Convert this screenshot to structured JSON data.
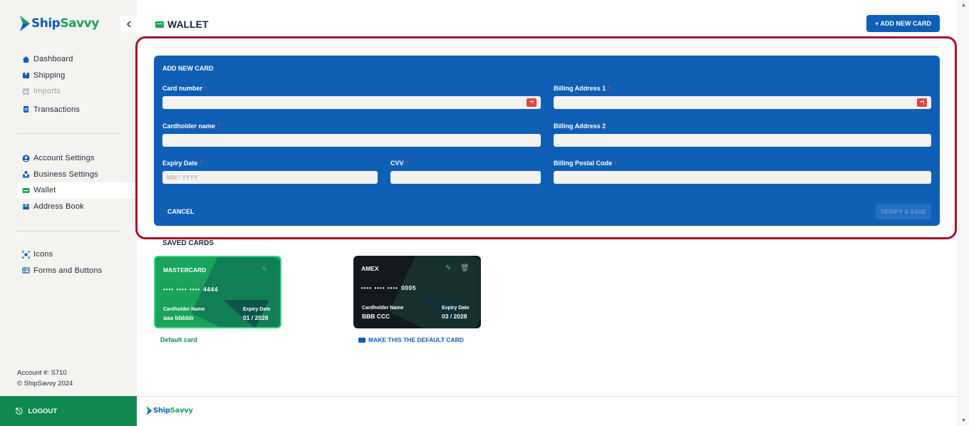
{
  "brand": {
    "ship": "Ship",
    "savvy": "Savvy"
  },
  "sidebar": {
    "collapse_icon": "chevron-left-icon",
    "main_items": [
      {
        "label": "Dashboard",
        "icon": "home-icon"
      },
      {
        "label": "Shipping",
        "icon": "box-icon"
      },
      {
        "label": "Imports",
        "icon": "import-icon"
      },
      {
        "label": "Transactions",
        "icon": "document-icon"
      }
    ],
    "settings_items": [
      {
        "label": "Account Settings",
        "icon": "user-circle-icon"
      },
      {
        "label": "Business Settings",
        "icon": "users-icon"
      },
      {
        "label": "Wallet",
        "icon": "wallet-icon"
      },
      {
        "label": "Address Book",
        "icon": "address-book-icon"
      }
    ],
    "dev_items": [
      {
        "label": "Icons",
        "icon": "scan-icon"
      },
      {
        "label": "Forms and Buttons",
        "icon": "list-icon"
      }
    ],
    "account_number": "Account #: S710",
    "copyright": "© ShipSavvy 2024",
    "logout": "LOGOUT"
  },
  "header": {
    "title": "WALLET",
    "add_card_button": "+ ADD NEW CARD"
  },
  "form": {
    "title": "ADD NEW CARD",
    "card_number_label": "Card number",
    "cardholder_label": "Cardholder name",
    "expiry_label": "Expiry Date",
    "expiry_placeholder": "MM / YYYY",
    "cvv_label": "CVV",
    "billing1_label": "Billing Address 1",
    "billing2_label": "Billing Address 2",
    "postal_label": "Billing Postal Code",
    "required_mark": "*",
    "cancel": "CANCEL",
    "verify": "VERIFY & SAVE",
    "card_icon_text": "•••|"
  },
  "saved": {
    "title": "SAVED CARDS",
    "cards": [
      {
        "brand": "MASTERCARD",
        "masked": "•••• •••• ••••",
        "last4": "4444",
        "holder_label": "Cardholder Name",
        "holder": "aaa bbbbb",
        "expiry_label": "Expiry Date",
        "expiry": "01 / 2028"
      },
      {
        "brand": "AMEX",
        "masked": "•••• •••• ••••",
        "last4": "0005",
        "holder_label": "Cardholder Name",
        "holder": "BBB CCC",
        "expiry_label": "Expiry Date",
        "expiry": "03 / 2028"
      }
    ],
    "default_label": "Default card",
    "make_default": "MAKE THIS THE DEFAULT CARD"
  },
  "colors": {
    "primary_blue": "#0e5fb5",
    "brand_green": "#1aa35a",
    "highlight_red": "#a3142f",
    "sidebar_bg": "#f5f3ef"
  }
}
